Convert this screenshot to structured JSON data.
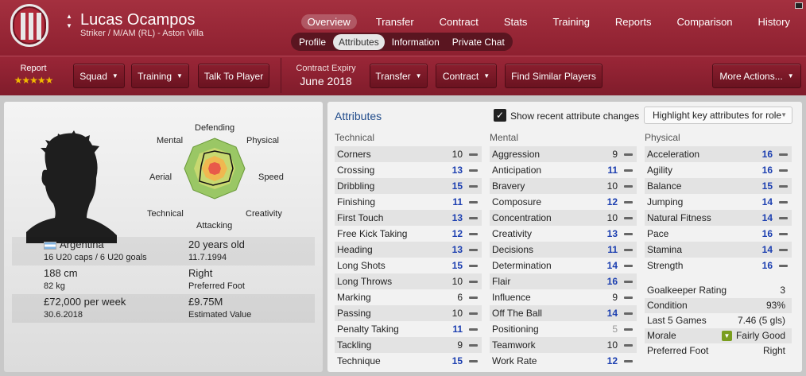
{
  "player": {
    "name": "Lucas Ocampos",
    "subtitle": "Striker / M/AM (RL) - Aston Villa"
  },
  "topnav": [
    "Overview",
    "Transfer",
    "Contract",
    "Stats",
    "Training",
    "Reports",
    "Comparison",
    "History"
  ],
  "subtabs": [
    "Profile",
    "Attributes",
    "Information",
    "Private Chat"
  ],
  "toolbar": {
    "report_label": "Report",
    "stars": "★★★★★",
    "stars_value": 4.5,
    "squad": "Squad",
    "training": "Training",
    "talk": "Talk To Player",
    "contract_label": "Contract Expiry",
    "contract_date": "June 2018",
    "transfer": "Transfer",
    "contract": "Contract",
    "similar": "Find Similar Players",
    "more": "More Actions..."
  },
  "radar": {
    "labels": [
      "Defending",
      "Physical",
      "Speed",
      "Creativity",
      "Attacking",
      "Technical",
      "Aerial",
      "Mental"
    ]
  },
  "bio": {
    "nationality": "Argentina",
    "caps": "16 U20 caps / 6 U20 goals",
    "age": "20 years old",
    "dob": "11.7.1994",
    "height": "188 cm",
    "weight": "82 kg",
    "foot": "Right",
    "foot_label": "Preferred Foot",
    "wage": "£72,000 per week",
    "wage_until": "30.6.2018",
    "value": "£9.75M",
    "value_label": "Estimated Value"
  },
  "attributes_panel": {
    "title": "Attributes",
    "show_changes": "Show recent attribute changes",
    "highlight": "Highlight key attributes for role"
  },
  "technical": {
    "title": "Technical",
    "rows": [
      {
        "name": "Corners",
        "value": "10"
      },
      {
        "name": "Crossing",
        "value": "13"
      },
      {
        "name": "Dribbling",
        "value": "15"
      },
      {
        "name": "Finishing",
        "value": "11"
      },
      {
        "name": "First Touch",
        "value": "13"
      },
      {
        "name": "Free Kick Taking",
        "value": "12"
      },
      {
        "name": "Heading",
        "value": "13"
      },
      {
        "name": "Long Shots",
        "value": "15"
      },
      {
        "name": "Long Throws",
        "value": "10"
      },
      {
        "name": "Marking",
        "value": "6"
      },
      {
        "name": "Passing",
        "value": "10"
      },
      {
        "name": "Penalty Taking",
        "value": "11"
      },
      {
        "name": "Tackling",
        "value": "9"
      },
      {
        "name": "Technique",
        "value": "15"
      }
    ]
  },
  "mental": {
    "title": "Mental",
    "rows": [
      {
        "name": "Aggression",
        "value": "9"
      },
      {
        "name": "Anticipation",
        "value": "11"
      },
      {
        "name": "Bravery",
        "value": "10"
      },
      {
        "name": "Composure",
        "value": "12"
      },
      {
        "name": "Concentration",
        "value": "10"
      },
      {
        "name": "Creativity",
        "value": "13"
      },
      {
        "name": "Decisions",
        "value": "11"
      },
      {
        "name": "Determination",
        "value": "14"
      },
      {
        "name": "Flair",
        "value": "16"
      },
      {
        "name": "Influence",
        "value": "9"
      },
      {
        "name": "Off The Ball",
        "value": "14"
      },
      {
        "name": "Positioning",
        "value": "5"
      },
      {
        "name": "Teamwork",
        "value": "10"
      },
      {
        "name": "Work Rate",
        "value": "12"
      }
    ]
  },
  "physical": {
    "title": "Physical",
    "rows": [
      {
        "name": "Acceleration",
        "value": "16"
      },
      {
        "name": "Agility",
        "value": "16"
      },
      {
        "name": "Balance",
        "value": "15"
      },
      {
        "name": "Jumping",
        "value": "14"
      },
      {
        "name": "Natural Fitness",
        "value": "14"
      },
      {
        "name": "Pace",
        "value": "16"
      },
      {
        "name": "Stamina",
        "value": "14"
      },
      {
        "name": "Strength",
        "value": "16"
      }
    ]
  },
  "info": [
    {
      "name": "Goalkeeper Rating",
      "value": "3"
    },
    {
      "name": "Condition",
      "value": "93%"
    },
    {
      "name": "Last 5 Games",
      "value": "7.46 (5 gls)"
    },
    {
      "name": "Morale",
      "value": "Fairly Good"
    },
    {
      "name": "Preferred Foot",
      "value": "Right"
    }
  ],
  "colors": {
    "header": "#9a2637",
    "highlight_value": "#1c3fb0"
  }
}
